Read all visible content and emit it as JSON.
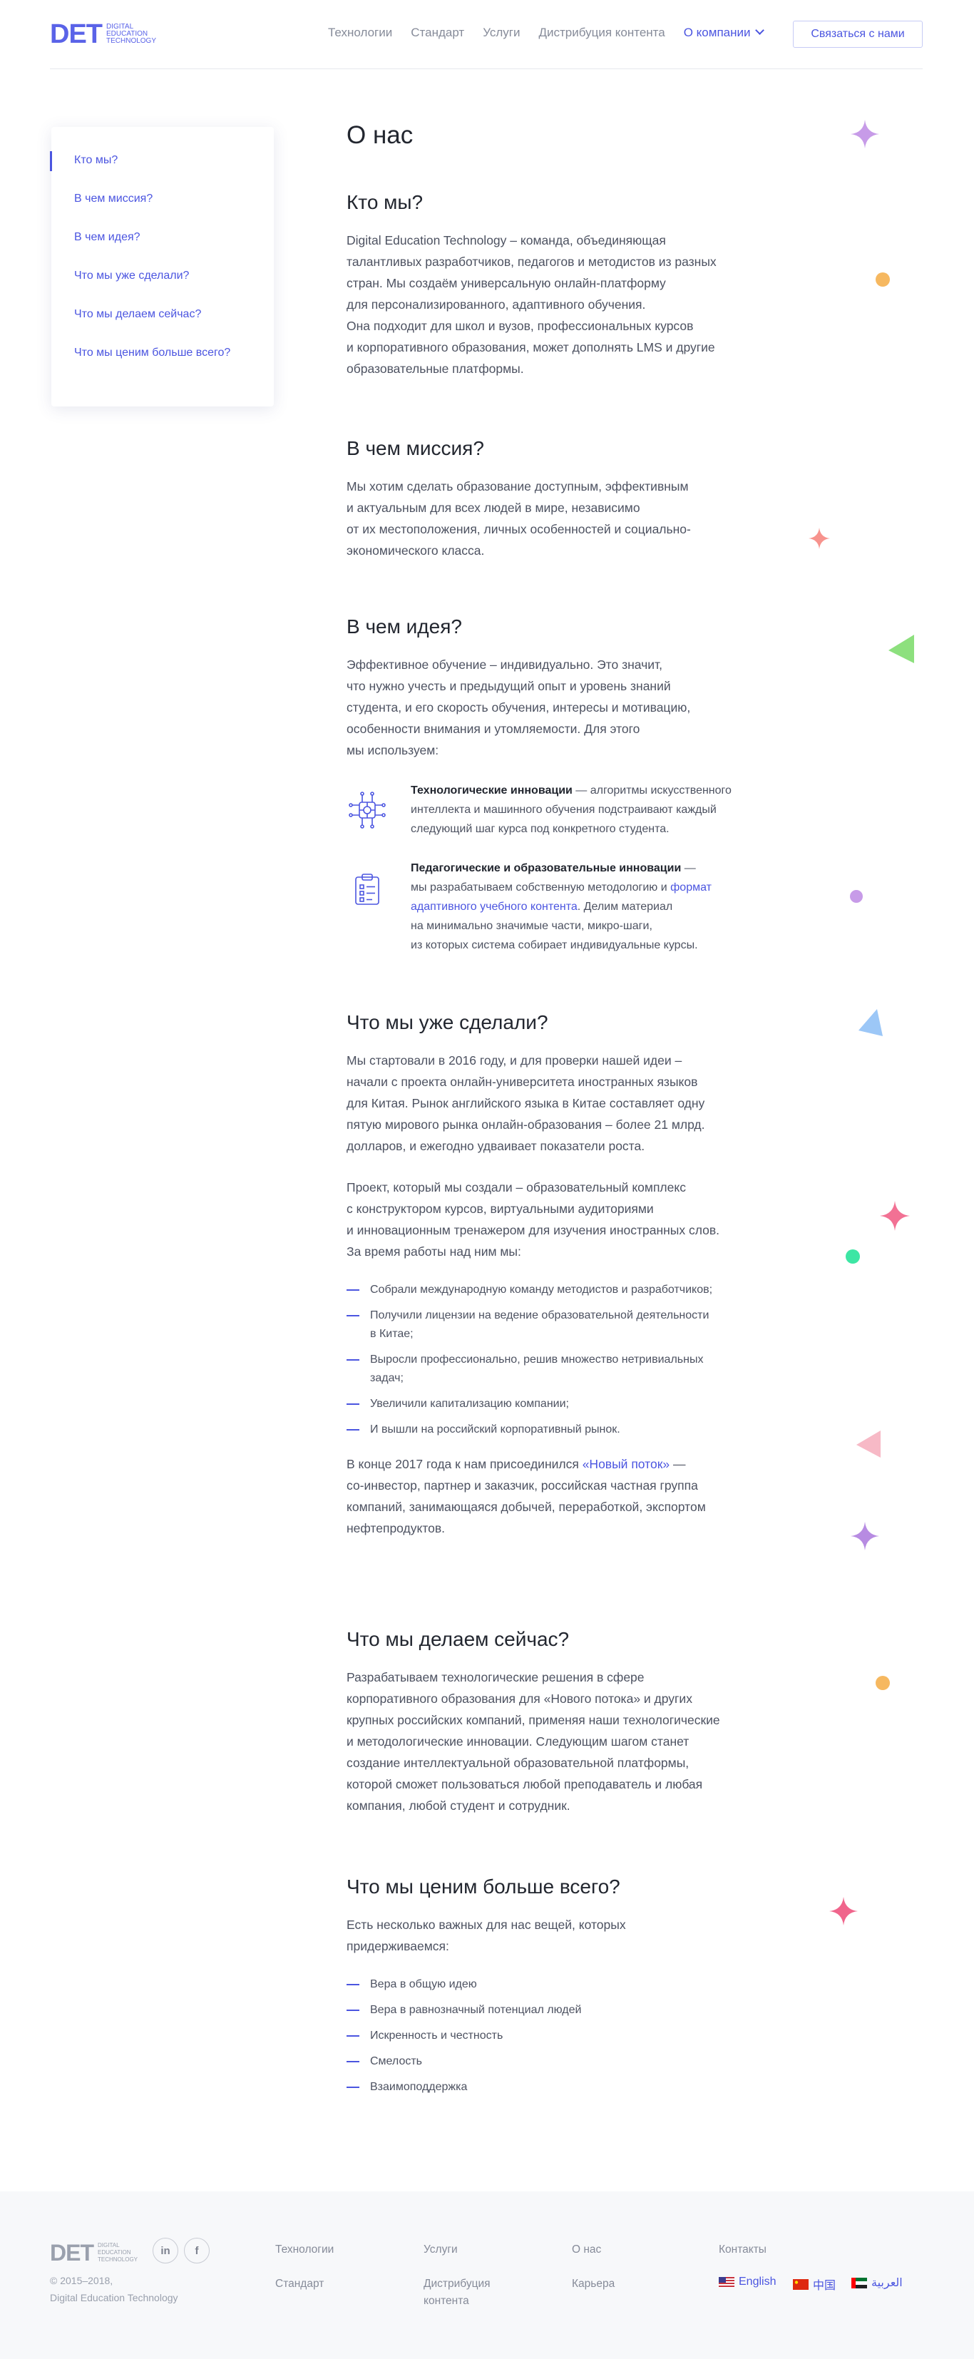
{
  "header": {
    "logo_mark": "DET",
    "logo_sub": "DIGITAL EDUCATION TECHNOLOGY",
    "nav": [
      "Технологии",
      "Стандарт",
      "Услуги",
      "Дистрибуция контента",
      "О компании"
    ],
    "contact_button": "Связаться с нами"
  },
  "toc": [
    "Кто мы?",
    "В чем миссия?",
    "В чем идея?",
    "Что мы уже сделали?",
    "Что мы делаем сейчас?",
    "Что мы ценим больше всего?"
  ],
  "page_title": "О нас",
  "who": {
    "title": "Кто мы?",
    "text": "Digital Education Technology – команда, объединяющая\nталантливых разработчиков, педагогов и методистов из разных\nстран. Мы создаём универсальную онлайн-платформу\nдля персонализированного, адаптивного обучения.\nОна подходит для школ и вузов, профессиональных курсов\nи корпоративного образования, может дополнять LMS и другие\nобразовательные платформы."
  },
  "mission": {
    "title": "В чем миссия?",
    "text": "Мы хотим сделать образование доступным, эффективным\nи актуальным для всех людей в мире, независимо\nот их местоположения, личных особенностей и социально-\nэкономического класса."
  },
  "idea": {
    "title": "В чем идея?",
    "text": "Эффективное обучение – индивидуально. Это значит,\nчто нужно учесть и предыдущий опыт и уровень знаний\nстудента, и его скорость обучения, интересы и мотивацию,\nособенности внимания и утомляемости. Для этого\nмы используем:",
    "f1_title": "Технологические инновации",
    "f1_text": " —  алгоритмы искусственного\nинтеллекта и машинного обучения подстраивают каждый\nследующий шаг курса под конкретного студента.",
    "f2_title": "Педагогические и образовательные инновации",
    "f2_text_a": " —\nмы разрабатываем собственную методологию и ",
    "f2_link": "формат\nадаптивного учебного контента",
    "f2_text_b": ". Делим материал\nна минимально значимые части, микро-шаги,\nиз которых система собирает индивидуальные курсы."
  },
  "done": {
    "title": "Что мы уже сделали?",
    "p1": "Мы стартовали в 2016 году, и для проверки нашей идеи –\nначали с проекта онлайн-университета иностранных языков\nдля Китая. Рынок английского языка в Китае составляет одну\nпятую мирового рынка онлайн-образования – более 21 млрд.\nдолларов, и ежегодно удваивает показатели роста.",
    "p2": "Проект, который мы создали – образовательный комплекс\nс конструктором курсов, виртуальными аудиториями\nи инновационным тренажером для изучения иностранных слов.\nЗа время работы над ним мы:",
    "list": [
      "Собрали международную команду методистов и разработчиков;",
      "Получили лицензии на ведение образовательной деятельности\nв Китае;",
      "Выросли профессионально, решив множество нетривиальных\nзадач;",
      "Увеличили капитализацию компании;",
      "И вышли на российский корпоративный рынок."
    ],
    "p3_a": "В конце 2017 года к нам присоединился ",
    "p3_link": "«Новый поток»",
    "p3_b": " —\nсо-инвестор, партнер и заказчик, российская частная группа\nкомпаний, занимающаяся добычей, переработкой, экспортом\nнефтепродуктов."
  },
  "now": {
    "title": "Что мы делаем сейчас?",
    "text": "Разрабатываем технологические решения в сфере\nкорпоративного образования для «Нового потока» и других\nкрупных российских компаний, применяя наши технологические\nи методологические инновации. Следующим шагом станет\nсоздание интеллектуальной образовательной платформы,\nкоторой сможет пользоваться любой преподаватель и любая\nкомпания, любой студент и сотрудник."
  },
  "values": {
    "title": "Что мы ценим больше всего?",
    "text": "Есть несколько важных для нас вещей, которых\nпридерживаемся:",
    "list": [
      "Вера в общую идею",
      "Вера в равнозначный потенциал людей",
      "Искренность и честность",
      "Смелость",
      "Взаимоподдержка"
    ]
  },
  "footer": {
    "logo_mark": "DET",
    "logo_sub": "DIGITAL EDUCATION TECHNOLOGY",
    "social": [
      "in",
      "f"
    ],
    "copyright": "© 2015–2018,\nDigital Education Technology",
    "links": [
      "Технологии",
      "Стандарт",
      "Услуги",
      "Дистрибуция\nконтента",
      "О нас",
      "Карьера",
      "Контакты"
    ],
    "langs": [
      "English",
      "中国",
      "العربية"
    ]
  },
  "colors": {
    "accent": "#4b55e0",
    "text": "#4d5261",
    "heading": "#22262f",
    "muted": "#868b99",
    "footer_bg": "#f7f8fa"
  },
  "icons": [
    "chevron-down-icon",
    "ai-chip-icon",
    "clipboard-checklist-icon",
    "linkedin-icon",
    "facebook-icon",
    "flag-usa-icon",
    "flag-china-icon",
    "flag-uae-icon"
  ]
}
